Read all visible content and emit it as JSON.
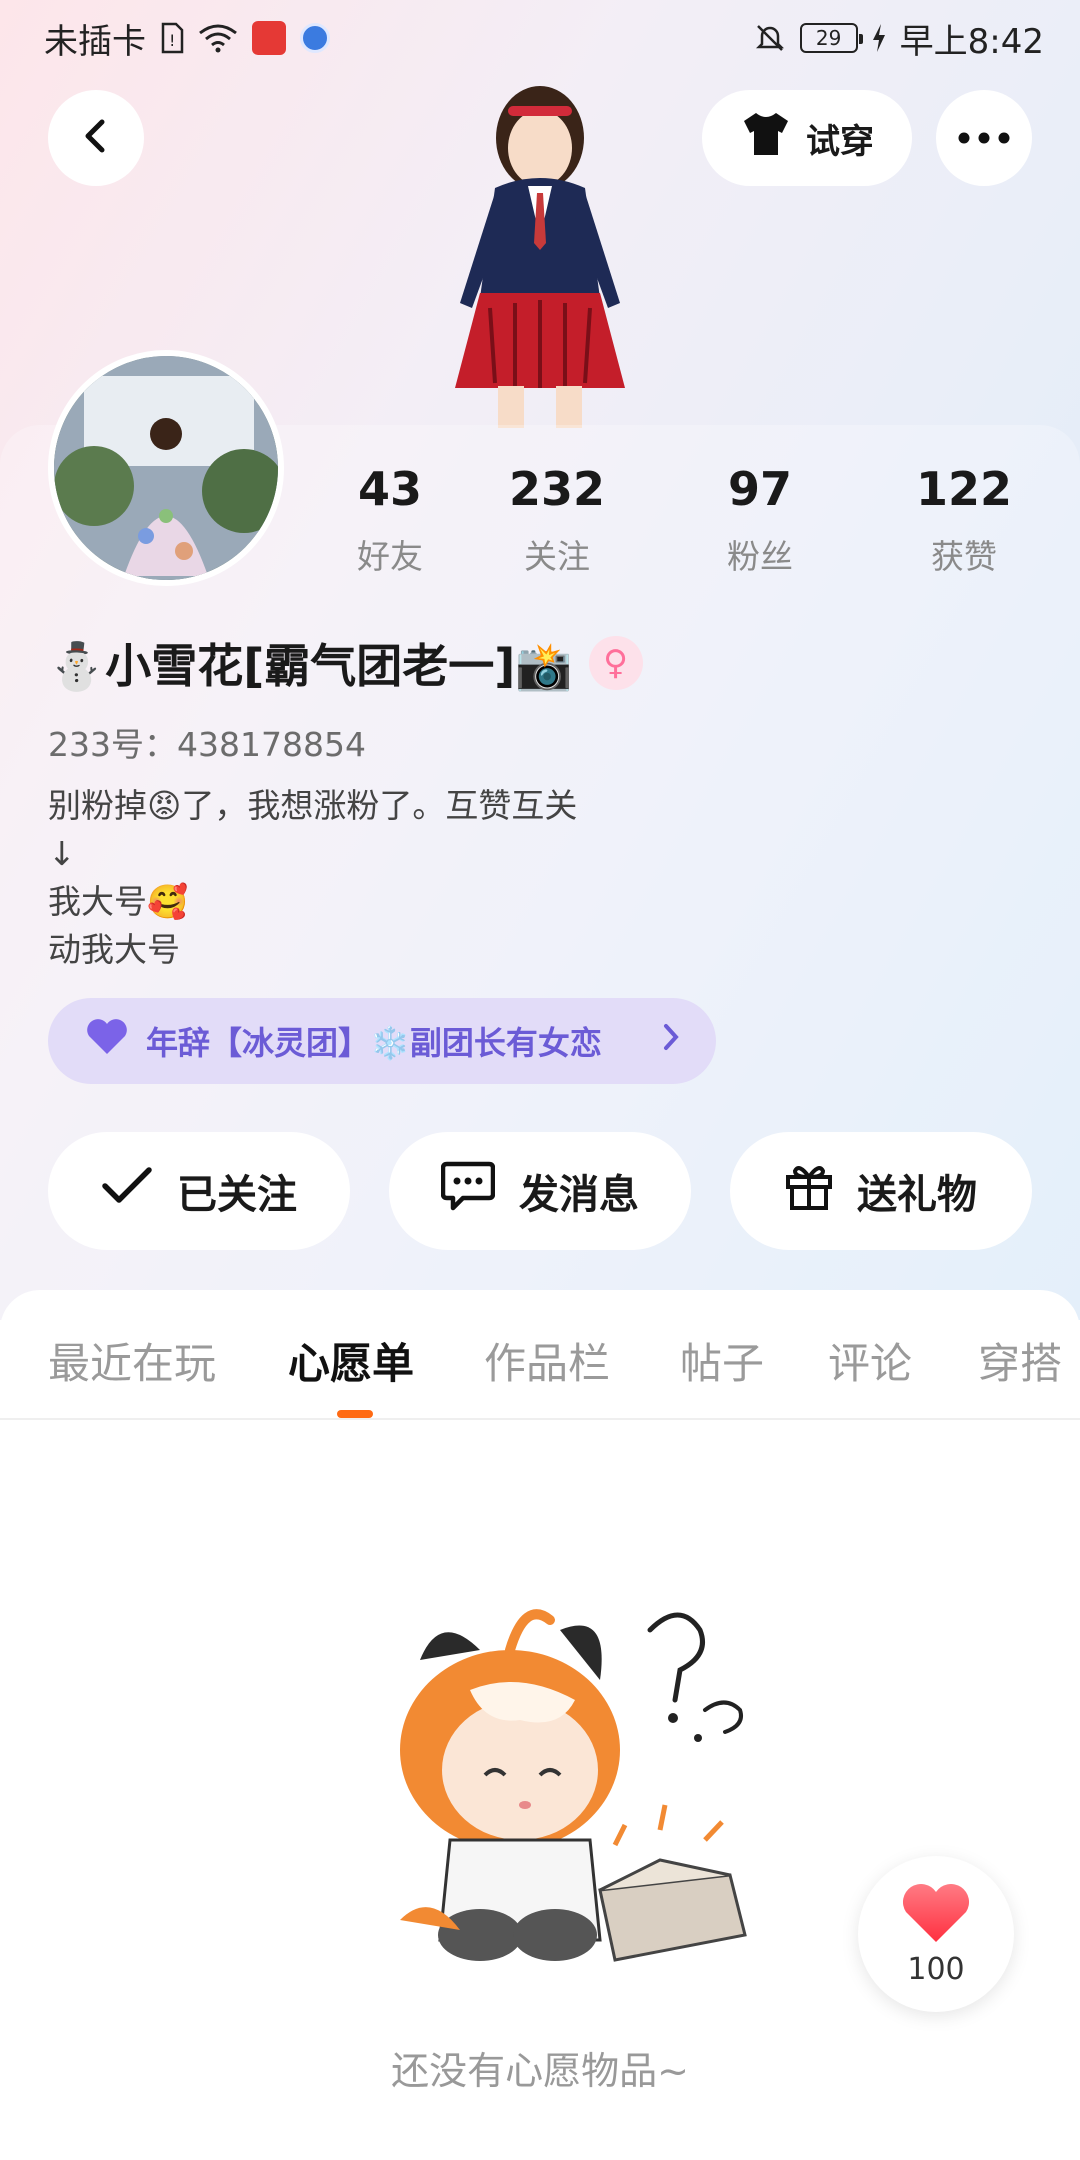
{
  "status_bar": {
    "carrier": "未插卡",
    "battery": "29",
    "time": "早上8:42"
  },
  "header": {
    "try_on_label": "试穿"
  },
  "stats": [
    {
      "value": "43",
      "label": "好友"
    },
    {
      "value": "232",
      "label": "关注"
    },
    {
      "value": "97",
      "label": "粉丝"
    },
    {
      "value": "122",
      "label": "获赞"
    }
  ],
  "profile": {
    "name": "⛄小雪花[霸气团老一]📸",
    "uid": "233号：438178854",
    "bio_lines": [
      "别粉掉😡了，我想涨粉了。互赞互关",
      "↓",
      "我大号🥰",
      "动我大号"
    ]
  },
  "group": {
    "label": "年辞【冰灵团】❄️副团长有女恋"
  },
  "actions": {
    "follow_label": "已关注",
    "message_label": "发消息",
    "gift_label": "送礼物"
  },
  "tabs": [
    "最近在玩",
    "心愿单",
    "作品栏",
    "帖子",
    "评论",
    "穿搭"
  ],
  "active_tab": "心愿单",
  "empty_state": {
    "text": "还没有心愿物品~"
  },
  "like": {
    "count": "100"
  },
  "colors": {
    "accent": "#ff6a13",
    "group_text": "#6b5bd6",
    "group_bg": "#e2dcf8",
    "heart": "#ff4d5a"
  }
}
